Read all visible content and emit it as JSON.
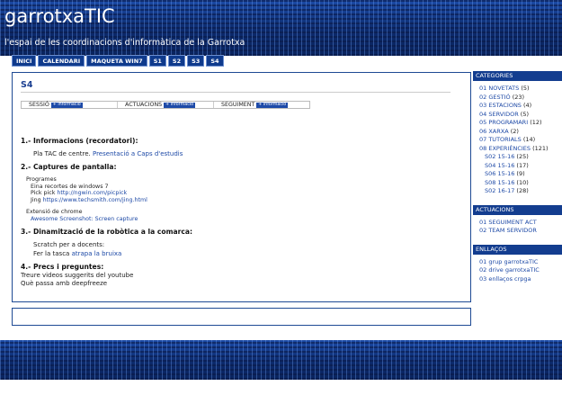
{
  "header": {
    "title": "garrotxaTIC",
    "subtitle": "l'espai de les coordinacions d'informàtica de la Garrotxa"
  },
  "nav": [
    "INICI",
    "CALENDARI",
    "MAQUETA WIN7",
    "S1",
    "S2",
    "S3",
    "S4"
  ],
  "post": {
    "title": "S4",
    "nav_row": [
      {
        "label": "SESSIÓ",
        "badge": "+ informació"
      },
      {
        "label": "ACTUACIONS",
        "badge": "+ informació"
      },
      {
        "label": "SEGUIMENT",
        "badge": "+ informació"
      }
    ],
    "s1": {
      "title": "1.- Informacions (recordatori):",
      "text": "Pla TAC de centre. ",
      "link": "Presentació a Caps d'estudis"
    },
    "s2": {
      "title": "2.- Captures de pantalla:",
      "programes": "Programes",
      "line1": "Eina recortes de windows 7",
      "line2_label": "Pick pick ",
      "line2_link": "http://ngwin.com/picpick",
      "line3_label": "Jing ",
      "line3_link": "https://www.techsmith.com/jing.html",
      "ext": "Extensió de chrome",
      "ext_link": "Awesome Screenshot: Screen capture"
    },
    "s3": {
      "title": "3.- Dinamització de la robòtica a la comarca:",
      "line1": "Scratch per a docents:",
      "line2_text": "Fer la tasca ",
      "line2_link": "atrapa la bruixa"
    },
    "s4": {
      "title": "4.- Precs i preguntes:",
      "line1": "Treure videos suggerits del youtube",
      "line2": "Què passa amb deepfreeze"
    }
  },
  "sidebar": {
    "categories": {
      "title": "CATEGORIES",
      "items": [
        {
          "label": "01 NOVETATS",
          "count": " (5)"
        },
        {
          "label": "02 GESTIÓ",
          "count": " (23)"
        },
        {
          "label": "03 ESTACIONS",
          "count": " (4)"
        },
        {
          "label": "04 SERVIDOR",
          "count": " (5)"
        },
        {
          "label": "05 PROGRAMARI",
          "count": " (12)"
        },
        {
          "label": "06 XARXA",
          "count": " (2)"
        },
        {
          "label": "07 TUTORIALS",
          "count": " (14)"
        },
        {
          "label": "08 EXPERIÈNCIES",
          "count": " (121)"
        }
      ],
      "subitems": [
        {
          "label": "S02 15-16",
          "count": " (25)"
        },
        {
          "label": "S04 15-16",
          "count": " (17)"
        },
        {
          "label": "S06 15-16",
          "count": " (9)"
        },
        {
          "label": "S08 15-16",
          "count": " (10)"
        },
        {
          "label": "S02 16-17",
          "count": " (28)"
        }
      ]
    },
    "actuacions": {
      "title": "ACTUACIONS",
      "items": [
        "01 SEGUIMENT ACT",
        "02 TEAM SERVIDOR"
      ]
    },
    "enllacos": {
      "title": "ENLLAÇOS",
      "items": [
        "01 grup garrotxaTIC",
        "02 drive garrotxaTIC",
        "03 enllaços crpga"
      ]
    }
  }
}
